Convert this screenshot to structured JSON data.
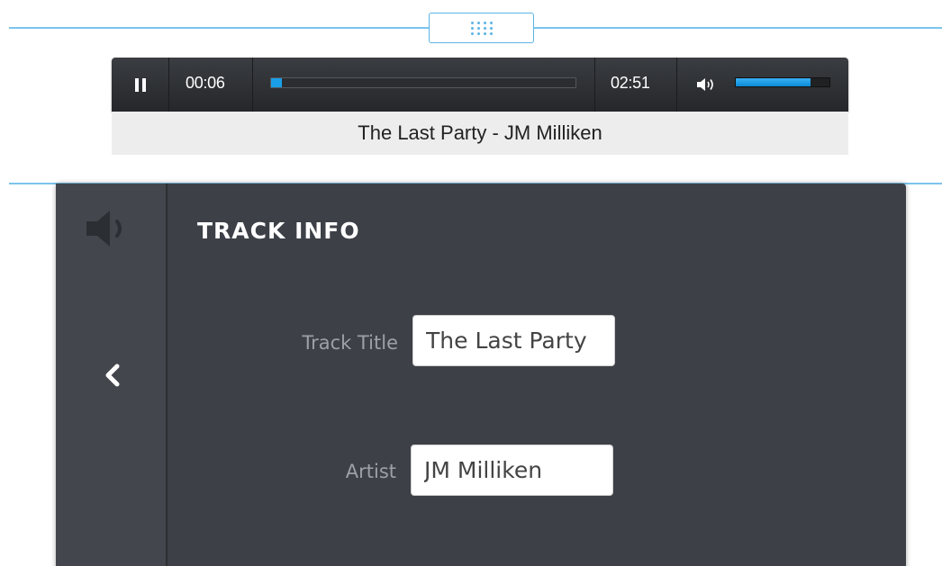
{
  "player": {
    "current_time": "00:06",
    "total_time": "02:51",
    "progress": 0.035,
    "volume": 0.8,
    "now_playing": "The Last Party - JM Milliken"
  },
  "track_info": {
    "title": "TRACK INFO",
    "fields": {
      "track_title": {
        "label": "Track Title",
        "value": "The Last Party"
      },
      "artist": {
        "label": "Artist",
        "value": "JM Milliken"
      }
    }
  },
  "icons": {
    "pause": "pause-icon",
    "volume": "volume-icon",
    "speaker": "speaker-icon",
    "back": "chevron-left-icon"
  },
  "colors": {
    "accent": "#1a9ee8",
    "guide": "#7cc4ec",
    "panel": "#3d4147",
    "player": "#2e3033"
  }
}
